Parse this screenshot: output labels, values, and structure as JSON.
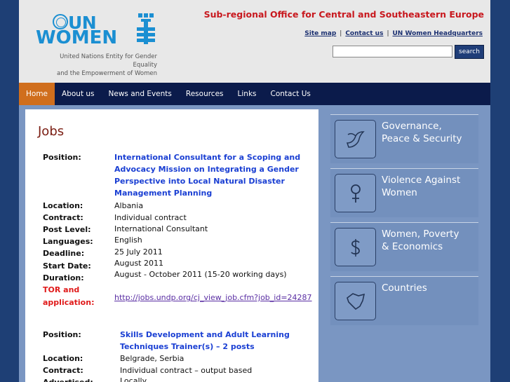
{
  "header": {
    "logo": {
      "un": "UN",
      "women": "WOMEN",
      "tagline_1": "United Nations Entity for Gender Equality",
      "tagline_2": "and the Empowerment of Women"
    },
    "office_title": "Sub-regional Office for Central and Southeastern Europe",
    "links": [
      "Site map",
      "Contact us",
      "UN Women Headquarters"
    ],
    "search": {
      "placeholder": "",
      "button_label": "search"
    }
  },
  "nav": {
    "items": [
      "Home",
      "About us",
      "News and Events",
      "Resources",
      "Links",
      "Contact Us"
    ],
    "active": "Home"
  },
  "content": {
    "title": "Jobs",
    "job1": {
      "position_label": "Position:",
      "position": [
        "International Consultant for a Scoping and",
        "Advocacy Mission on Integrating a Gender",
        "Perspective into Local Natural Disaster",
        "Management Planning"
      ],
      "location_label": "Location:",
      "location": "Albania",
      "contract_label": "Contract:",
      "contract": "Individual contract",
      "post_level_label": "Post Level:",
      "post_level": "International Consultant",
      "languages_label": "Languages:",
      "languages": "English",
      "deadline_label": "Deadline:",
      "deadline": "25 July 2011",
      "start_date_label": "Start Date:",
      "start_date": "August 2011",
      "duration_label": "Duration:",
      "duration": "August - October 2011 (15-20 working days)",
      "tor_label_1": "TOR and",
      "tor_label_2": "application:",
      "tor_link": "http://jobs.undp.org/cj_view_job.cfm?job_id=24287"
    },
    "job2": {
      "position_label": "Position:",
      "position": [
        "Skills Development and Adult Learning",
        "Techniques Trainer(s) – 2 posts"
      ],
      "location_label": "Location:",
      "location": "Belgrade, Serbia",
      "contract_label": "Contract:",
      "contract": "Individual contract – output based",
      "advertised_label": "Advertised:",
      "advertised": "Locally"
    }
  },
  "sidebar": {
    "items": [
      {
        "label": "Governance,\nPeace & Security",
        "icon": "dove-icon"
      },
      {
        "label": "Violence Against\nWomen",
        "icon": "female-symbol-icon"
      },
      {
        "label": "Women, Poverty\n& Economics",
        "icon": "dollar-icon"
      },
      {
        "label": "Countries",
        "icon": "map-icon"
      }
    ]
  },
  "colors": {
    "header_bg": "#e8e8e8",
    "nav_bg": "#0b1b4b",
    "nav_active": "#d06e1d",
    "office_title": "#c8181e",
    "logo_blue": "#1b8fd2",
    "position_blue": "#1a3fd3",
    "tor_red": "#e01a1a",
    "page_bg": "#7a96c2"
  }
}
